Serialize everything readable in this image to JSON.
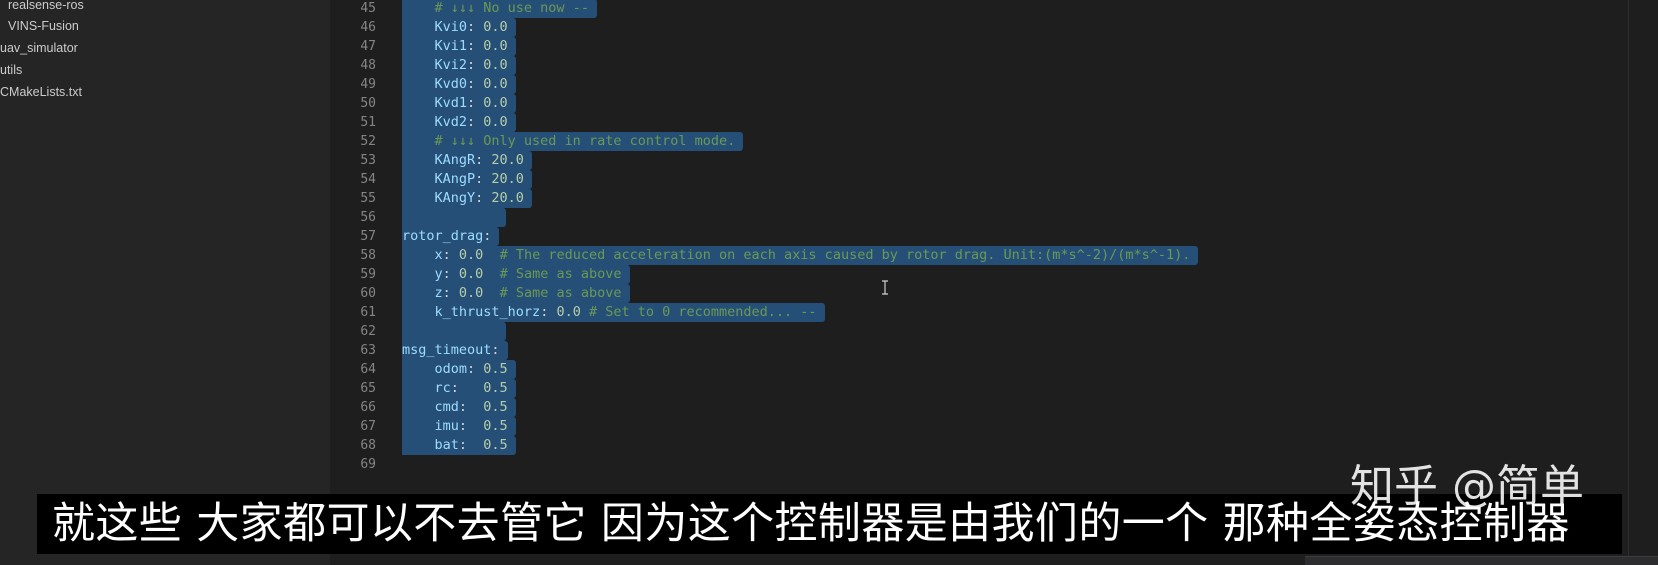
{
  "sidebar": {
    "items": [
      {
        "label": "realsense-ros"
      },
      {
        "label": "VINS-Fusion"
      },
      {
        "label": "uav_simulator"
      },
      {
        "label": "utils"
      },
      {
        "label": "CMakeLists.txt"
      }
    ]
  },
  "editor": {
    "lines": [
      {
        "num": "45",
        "indent": "    ",
        "comment": "# ↓↓↓ No use now --"
      },
      {
        "num": "46",
        "indent": "    ",
        "key": "Kvi0",
        "sep": ": ",
        "value": "0.0"
      },
      {
        "num": "47",
        "indent": "    ",
        "key": "Kvi1",
        "sep": ": ",
        "value": "0.0"
      },
      {
        "num": "48",
        "indent": "    ",
        "key": "Kvi2",
        "sep": ": ",
        "value": "0.0"
      },
      {
        "num": "49",
        "indent": "    ",
        "key": "Kvd0",
        "sep": ": ",
        "value": "0.0"
      },
      {
        "num": "50",
        "indent": "    ",
        "key": "Kvd1",
        "sep": ": ",
        "value": "0.0"
      },
      {
        "num": "51",
        "indent": "    ",
        "key": "Kvd2",
        "sep": ": ",
        "value": "0.0"
      },
      {
        "num": "52",
        "indent": "    ",
        "comment": "# ↓↓↓ Only used in rate control mode."
      },
      {
        "num": "53",
        "indent": "    ",
        "key": "KAngR",
        "sep": ": ",
        "value": "20.0"
      },
      {
        "num": "54",
        "indent": "    ",
        "key": "KAngP",
        "sep": ": ",
        "value": "20.0"
      },
      {
        "num": "55",
        "indent": "    ",
        "key": "KAngY",
        "sep": ": ",
        "value": "20.0"
      },
      {
        "num": "56",
        "empty": true
      },
      {
        "num": "57",
        "indent": "",
        "key": "rotor_drag",
        "sep": ":"
      },
      {
        "num": "58",
        "indent": "    ",
        "key": "x",
        "sep": ": ",
        "value": "0.0",
        "gap": "  ",
        "comment": "# The reduced acceleration on each axis caused by rotor drag. Unit:(m*s^-2)/(m*s^-1)."
      },
      {
        "num": "59",
        "indent": "    ",
        "key": "y",
        "sep": ": ",
        "value": "0.0",
        "gap": "  ",
        "comment": "# Same as above"
      },
      {
        "num": "60",
        "indent": "    ",
        "key": "z",
        "sep": ": ",
        "value": "0.0",
        "gap": "  ",
        "comment": "# Same as above"
      },
      {
        "num": "61",
        "indent": "    ",
        "key": "k_thrust_horz",
        "sep": ": ",
        "value": "0.0",
        "gap": " ",
        "comment": "# Set to 0 recommended... --"
      },
      {
        "num": "62",
        "empty": true
      },
      {
        "num": "63",
        "indent": "",
        "key": "msg_timeout",
        "sep": ":"
      },
      {
        "num": "64",
        "indent": "    ",
        "key": "odom",
        "sep": ": ",
        "value": "0.5"
      },
      {
        "num": "65",
        "indent": "    ",
        "key": "rc",
        "sep": ":   ",
        "value": "0.5"
      },
      {
        "num": "66",
        "indent": "    ",
        "key": "cmd",
        "sep": ":  ",
        "value": "0.5"
      },
      {
        "num": "67",
        "indent": "    ",
        "key": "imu",
        "sep": ":  ",
        "value": "0.5"
      },
      {
        "num": "68",
        "indent": "    ",
        "key": "bat",
        "sep": ":  ",
        "value": "0.5"
      },
      {
        "num": "69",
        "unselected": true
      }
    ],
    "colors": {
      "selection": "#264f78",
      "key": "#9cdcfe",
      "number": "#b5cea8",
      "comment": "#6a9955",
      "line_number": "#858585",
      "background": "#1e1e1e"
    }
  },
  "overlay": {
    "subtitle": "就这些 大家都可以不去管它 因为这个控制器是由我们的一个 那种全姿态控制器",
    "watermark": "知乎 @简单"
  }
}
